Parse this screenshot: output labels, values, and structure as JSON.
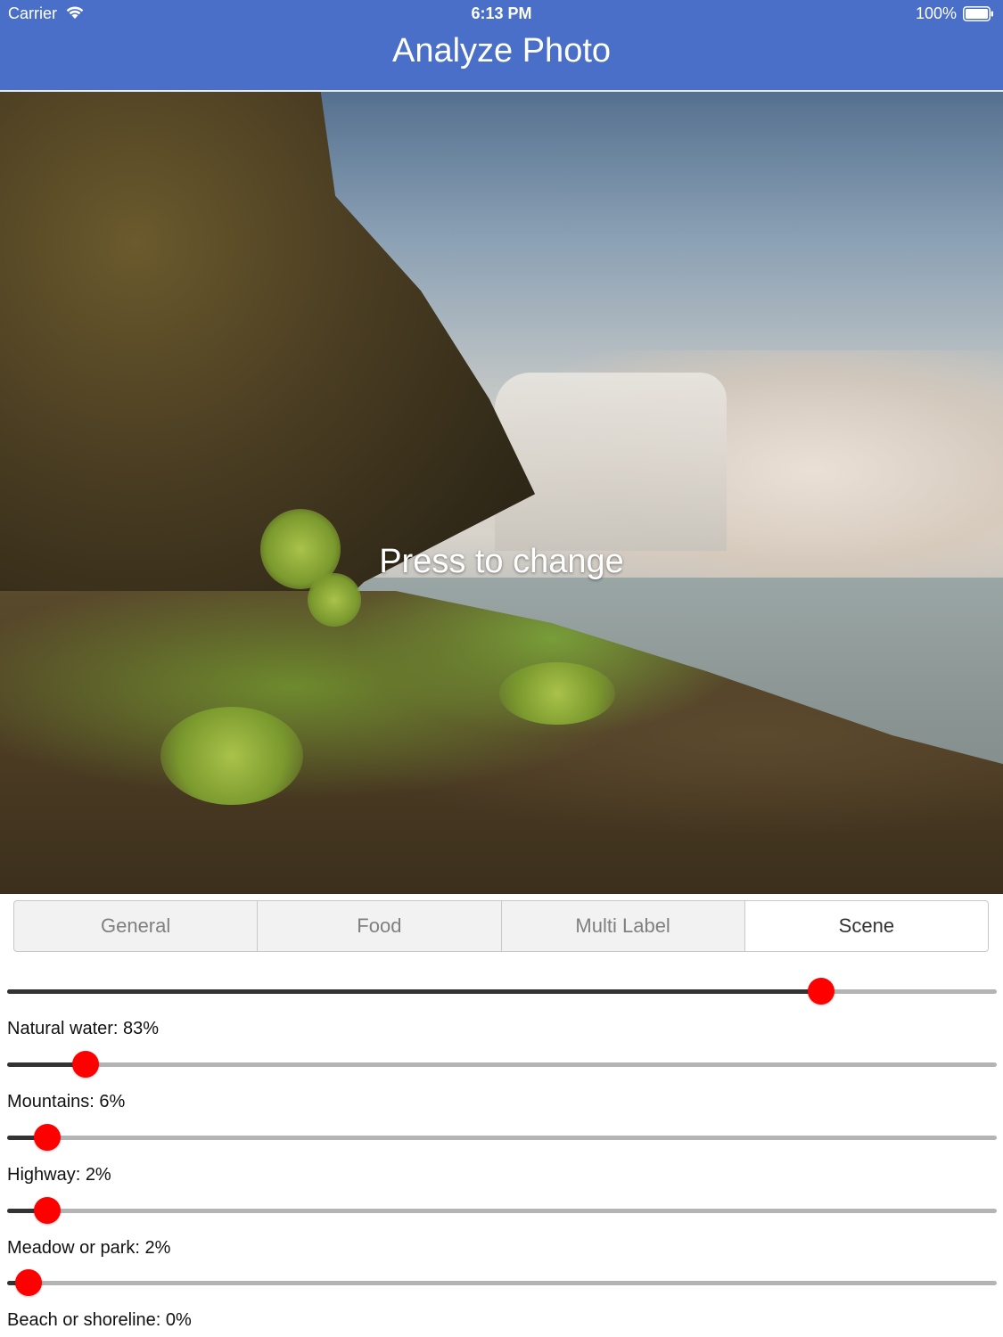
{
  "status_bar": {
    "carrier": "Carrier",
    "time": "6:13 PM",
    "battery_percent": "100%"
  },
  "nav": {
    "title": "Analyze Photo"
  },
  "photo": {
    "overlay_label": "Press to change"
  },
  "tabs": {
    "items": [
      {
        "label": "General",
        "selected": false
      },
      {
        "label": "Food",
        "selected": false
      },
      {
        "label": "Multi Label",
        "selected": false
      },
      {
        "label": "Scene",
        "selected": true
      }
    ]
  },
  "results": [
    {
      "label": "Natural water: 83%",
      "value": 0.83
    },
    {
      "label": "Mountains: 6%",
      "value": 0.06
    },
    {
      "label": "Highway: 2%",
      "value": 0.02
    },
    {
      "label": "Meadow or park: 2%",
      "value": 0.02
    },
    {
      "label": "Beach or shoreline: 0%",
      "value": 0.0
    }
  ],
  "colors": {
    "header_bg": "#4a6fc8",
    "slider_thumb": "#ff0000",
    "slider_fill": "#333333",
    "slider_track": "#b4b4b4"
  }
}
